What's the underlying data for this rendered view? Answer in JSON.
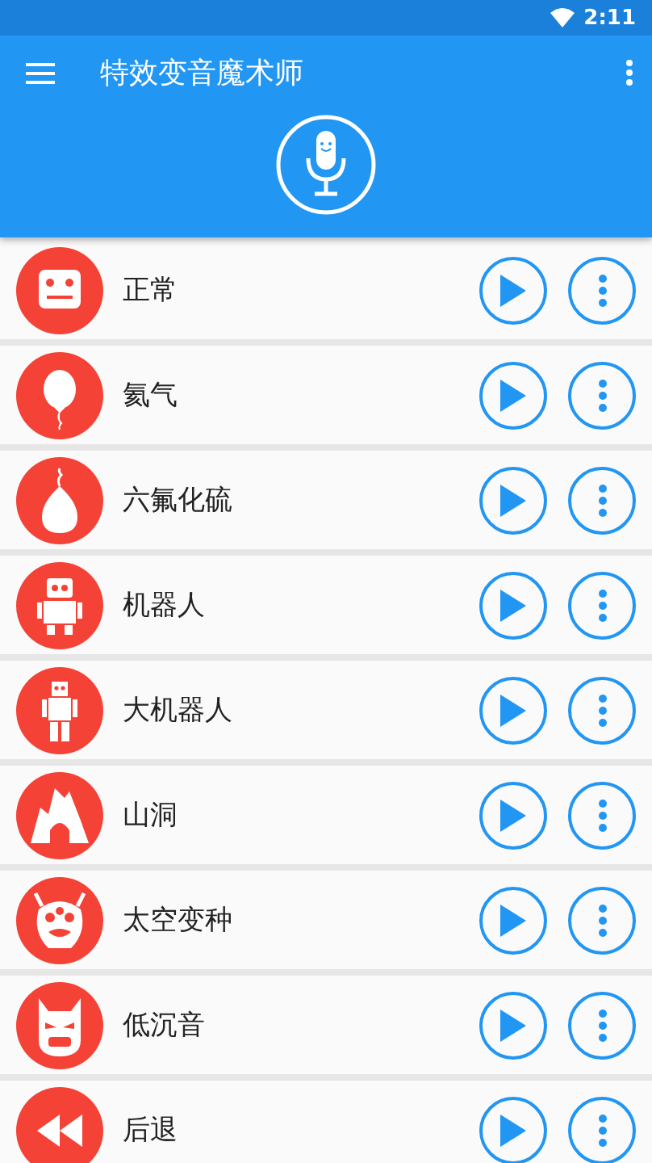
{
  "status_bar": {
    "time": "2:11"
  },
  "app_bar": {
    "title": "特效变音魔术师"
  },
  "effects": [
    {
      "name": "正常",
      "kind": "box-face"
    },
    {
      "name": "氦气",
      "kind": "balloon"
    },
    {
      "name": "六氟化硫",
      "kind": "drop"
    },
    {
      "name": "机器人",
      "kind": "robot"
    },
    {
      "name": "大机器人",
      "kind": "tall-robot"
    },
    {
      "name": "山洞",
      "kind": "cave"
    },
    {
      "name": "太空变种",
      "kind": "alien"
    },
    {
      "name": "低沉音",
      "kind": "mask"
    },
    {
      "name": "后退",
      "kind": "rewind"
    }
  ]
}
